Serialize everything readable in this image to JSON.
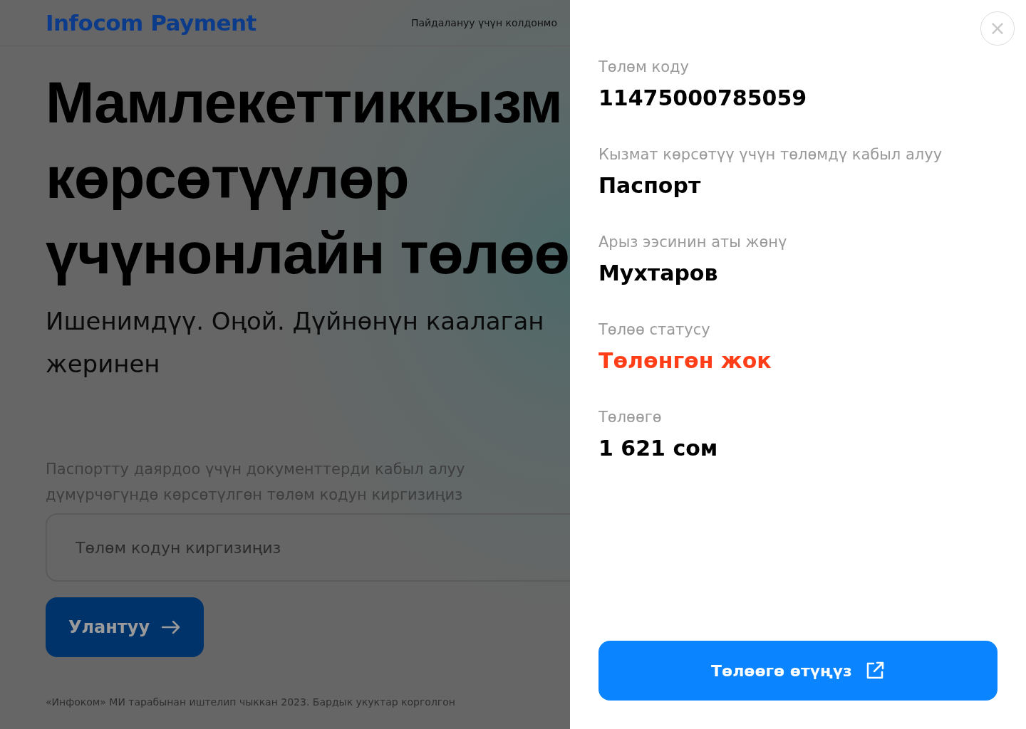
{
  "header": {
    "logo": "Infocom Payment",
    "nav_link": "Пайдалануу үчүн колдонмо"
  },
  "hero": {
    "title_lines": [
      "Мамлекеттиккызм",
      "көрсөтүүлөр",
      "үчүнонлайн төлөө"
    ],
    "subtitle": "Ишенимдүү. Оңой. Дүйнөнүн каалаган жеринен"
  },
  "form": {
    "hint": "Паспортту даярдоо үчүн документтерди кабыл алуу дүмүрчөгүндө көрсөтүлгөн төлөм кодун киргизиңиз",
    "placeholder": "Төлөм кодун киргизиңиз",
    "submit": "Улантуу"
  },
  "footer": "«Инфоком» МИ тарабынан иштелип чыккан 2023. Бардык укуктар корголгон",
  "drawer": {
    "close": "×",
    "fields": [
      {
        "label": "Төлөм коду",
        "value": "11475000785059",
        "kind": "normal"
      },
      {
        "label": "Кызмат көрсөтүү үчүн төлөмдү кабыл алуу",
        "value": "Паспорт",
        "kind": "normal"
      },
      {
        "label": "Арыз ээсинин аты жөнү",
        "value": "Мухтаров",
        "kind": "normal"
      },
      {
        "label": "Төлөө статусу",
        "value": "Төлөнгөн жок",
        "kind": "alert"
      },
      {
        "label": "Төлөөгө",
        "value": "1 621 сом",
        "kind": "normal"
      }
    ],
    "pay_button": "Төлөөгө өтүңүз"
  }
}
